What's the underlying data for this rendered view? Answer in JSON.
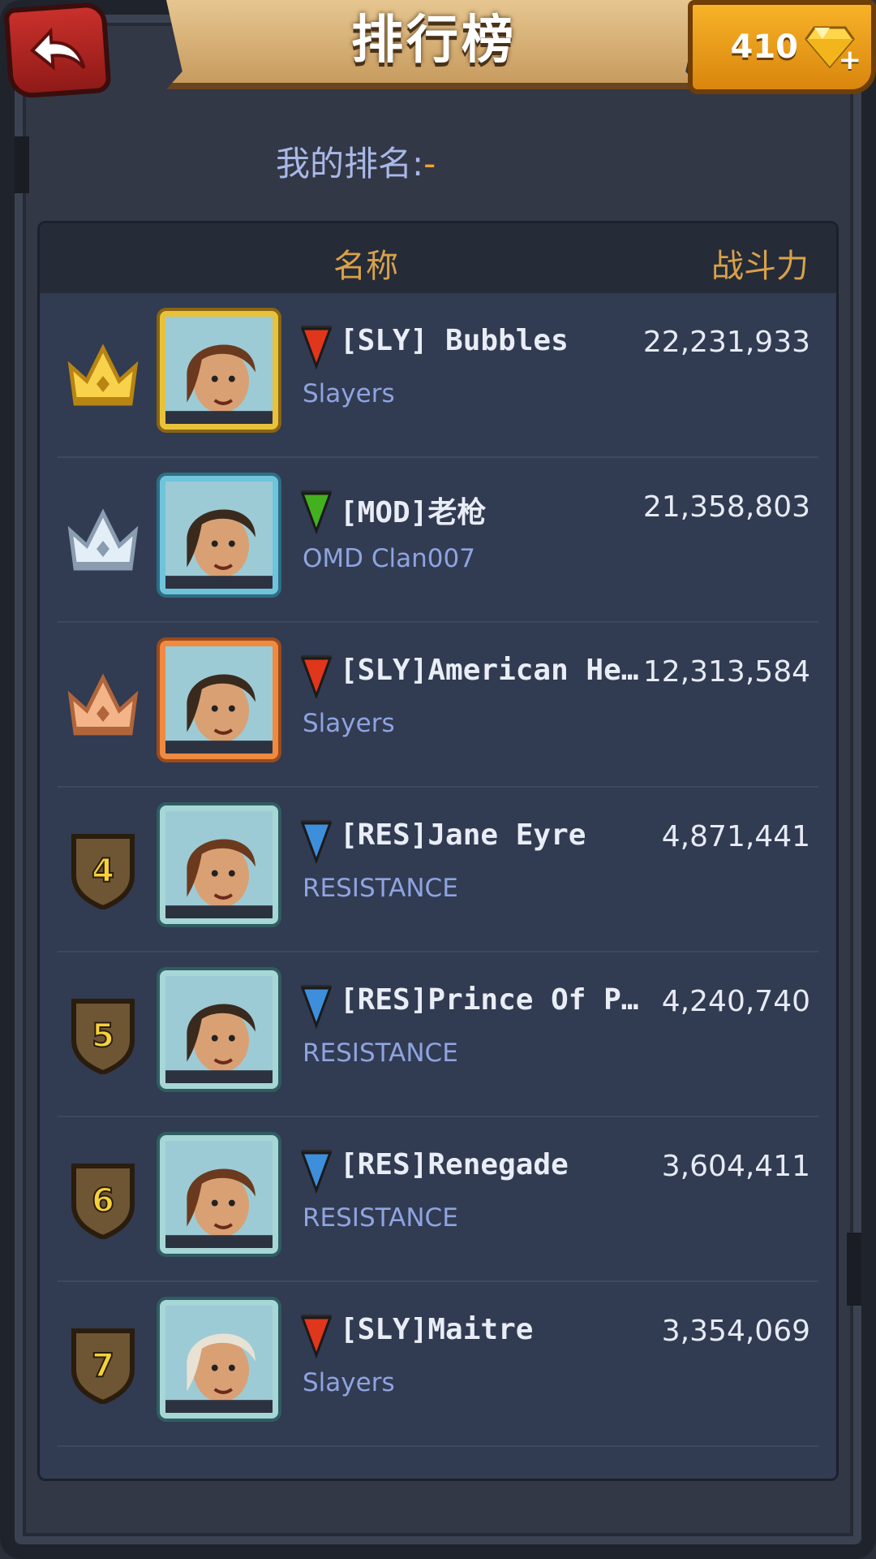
{
  "header": {
    "title": "排行榜",
    "gem_count": "410",
    "gem_plus": "+"
  },
  "my_rank": {
    "label": "我的排名:",
    "value": "-"
  },
  "table": {
    "col_name": "名称",
    "col_power": "战斗力"
  },
  "rows": [
    {
      "rank": "1",
      "badge": "gold-crown",
      "name": "[SLY] Bubbles",
      "clan": "Slayers",
      "power": "22,231,933",
      "flag_color": "#e0361b",
      "frame": "gold"
    },
    {
      "rank": "2",
      "badge": "silver-crown",
      "name": "[MOD]老枪",
      "clan": "OMD Clan007",
      "power": "21,358,803",
      "flag_color": "#43b01f",
      "frame": "silver"
    },
    {
      "rank": "3",
      "badge": "bronze-crown",
      "name": "[SLY]American Hero",
      "clan": "Slayers",
      "power": "12,313,584",
      "flag_color": "#e0361b",
      "frame": "bronze"
    },
    {
      "rank": "4",
      "badge": "shield",
      "name": "[RES]Jane Eyre",
      "clan": "RESISTANCE",
      "power": "4,871,441",
      "flag_color": "#3d8fdc",
      "frame": "plain"
    },
    {
      "rank": "5",
      "badge": "shield",
      "name": "[RES]Prince Of Pe...",
      "clan": "RESISTANCE",
      "power": "4,240,740",
      "flag_color": "#3d8fdc",
      "frame": "plain"
    },
    {
      "rank": "6",
      "badge": "shield",
      "name": "[RES]Renegade",
      "clan": "RESISTANCE",
      "power": "3,604,411",
      "flag_color": "#3d8fdc",
      "frame": "plain"
    },
    {
      "rank": "7",
      "badge": "shield",
      "name": "[SLY]Maitre",
      "clan": "Slayers",
      "power": "3,354,069",
      "flag_color": "#e0361b",
      "frame": "plain"
    }
  ]
}
